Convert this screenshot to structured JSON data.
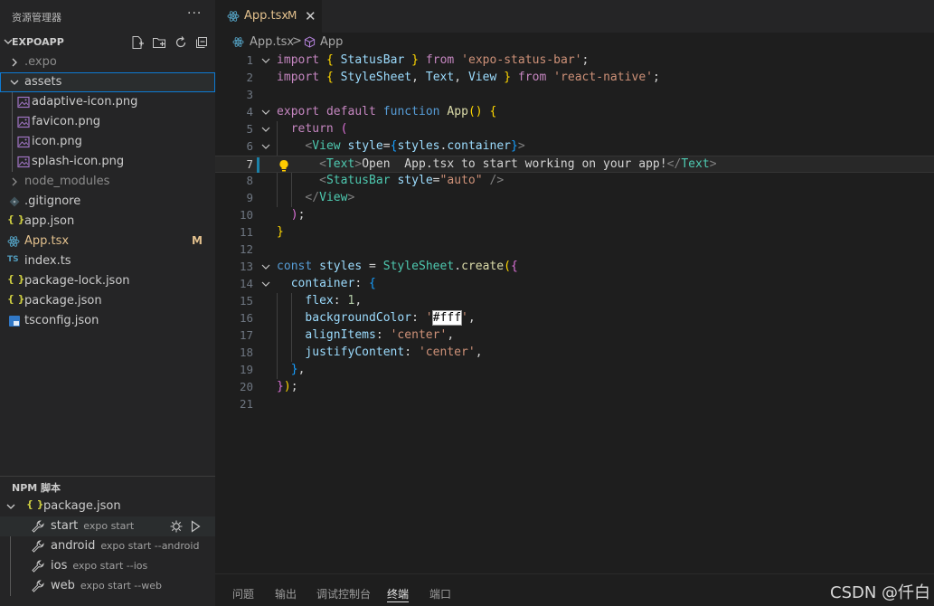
{
  "explorer": {
    "title": "资源管理器",
    "more": "···",
    "project": "EXPOAPP",
    "files": [
      {
        "label": ".expo"
      },
      {
        "label": "assets"
      },
      {
        "label": "adaptive-icon.png"
      },
      {
        "label": "favicon.png"
      },
      {
        "label": "icon.png"
      },
      {
        "label": "splash-icon.png"
      },
      {
        "label": "node_modules"
      },
      {
        "label": ".gitignore"
      },
      {
        "label": "app.json"
      },
      {
        "label": "App.tsx",
        "badge": "M"
      },
      {
        "label": "index.ts"
      },
      {
        "label": "package-lock.json"
      },
      {
        "label": "package.json"
      },
      {
        "label": "tsconfig.json"
      }
    ],
    "icon_text": {
      "json": "{ }",
      "ts": "TS"
    }
  },
  "npm": {
    "title": "NPM 脚本",
    "package": "package.json",
    "scripts": [
      {
        "name": "start",
        "cmd": "expo start"
      },
      {
        "name": "android",
        "cmd": "expo start --android"
      },
      {
        "name": "ios",
        "cmd": "expo start --ios"
      },
      {
        "name": "web",
        "cmd": "expo start --web"
      }
    ]
  },
  "editor": {
    "tab_label": "App.tsx",
    "tab_badge": "M",
    "tab_close": "✕",
    "breadcrumb": {
      "file": "App.tsx",
      "separator": ">",
      "symbol": "App"
    },
    "current_line": 7
  },
  "code_lines": [
    "import { StatusBar } from 'expo-status-bar';",
    "import { StyleSheet, Text, View } from 'react-native';",
    "",
    "export default function App() {",
    "  return (",
    "    <View style={styles.container}>",
    "      <Text>Open  App.tsx to start working on your app!</Text>",
    "      <StatusBar style=\"auto\" />",
    "    </View>",
    "  );",
    "}",
    "",
    "const styles = StyleSheet.create({",
    "  container: {",
    "    flex: 1,",
    "    backgroundColor: '#fff',",
    "    alignItems: 'center',",
    "    justifyContent: 'center',",
    "  },",
    "});",
    ""
  ],
  "panel": {
    "tabs": [
      "问题",
      "输出",
      "调试控制台",
      "终端",
      "端口"
    ],
    "active_tab": "终端"
  },
  "watermark": "CSDN @仟白",
  "colors": {
    "sidebar_bg": "#252526",
    "editor_bg": "#1e1e1e",
    "modified": "#e2c08d",
    "focus_border": "#0e7bd4",
    "react_icon": "#519aba",
    "json_icon": "#cbcb41",
    "ts_icon": "#519aba",
    "image_icon": "#a074c4"
  }
}
